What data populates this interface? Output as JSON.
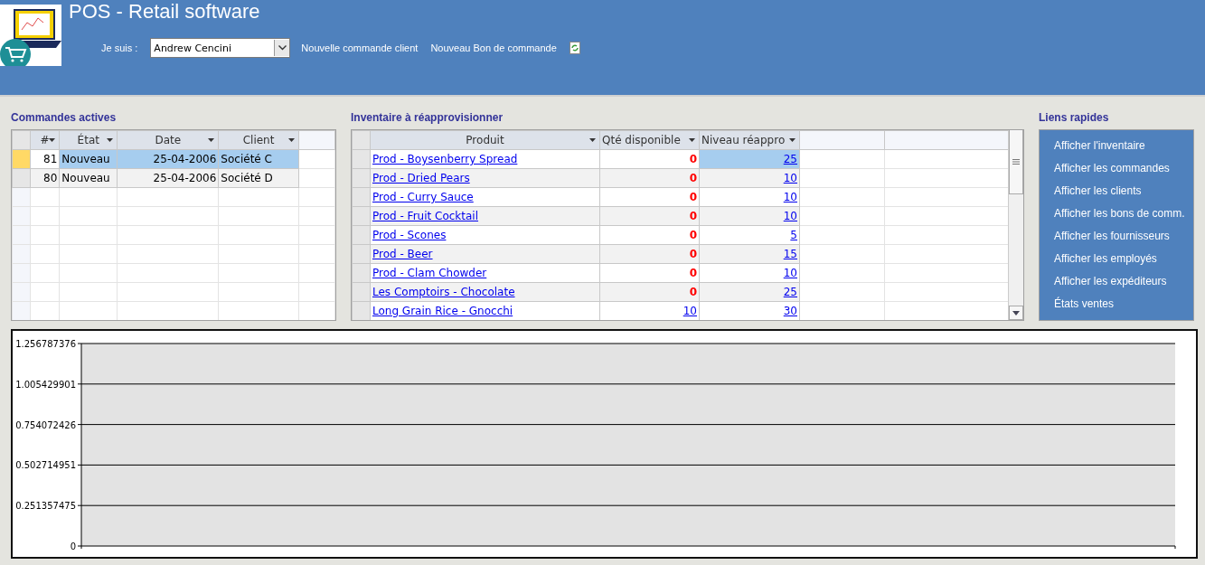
{
  "header": {
    "title": "POS - Retail software",
    "user_label": "Je suis :",
    "user_select": {
      "value": "Andrew Cencini"
    },
    "links": [
      "Nouvelle commande client",
      "Nouveau Bon de commande"
    ]
  },
  "orders": {
    "title": "Commandes actives",
    "columns": [
      "#",
      "État",
      "Date",
      "Client"
    ],
    "rows": [
      {
        "cells": [
          "81",
          "Nouveau",
          "25-04-2006",
          "Société C"
        ],
        "selected": true
      },
      {
        "cells": [
          "80",
          "Nouveau",
          "25-04-2006",
          "Société D"
        ],
        "selected": false
      }
    ]
  },
  "inventory": {
    "title": "Inventaire à réapprovisionner",
    "columns": [
      "Produit",
      "Qté disponible",
      "Niveau réappro"
    ],
    "rows": [
      {
        "product": "Prod - Boysenberry Spread",
        "qty": "0",
        "qty_alert": true,
        "level": "25",
        "selected": true
      },
      {
        "product": "Prod - Dried Pears",
        "qty": "0",
        "qty_alert": true,
        "level": "10",
        "selected": false
      },
      {
        "product": "Prod - Curry Sauce",
        "qty": "0",
        "qty_alert": true,
        "level": "10",
        "selected": false
      },
      {
        "product": "Prod - Fruit Cocktail",
        "qty": "0",
        "qty_alert": true,
        "level": "10",
        "selected": false
      },
      {
        "product": "Prod - Scones",
        "qty": "0",
        "qty_alert": true,
        "level": "5",
        "selected": false
      },
      {
        "product": "Prod - Beer",
        "qty": "0",
        "qty_alert": true,
        "level": "15",
        "selected": false
      },
      {
        "product": "Prod - Clam Chowder",
        "qty": "0",
        "qty_alert": true,
        "level": "10",
        "selected": false
      },
      {
        "product": "Les Comptoirs - Chocolate",
        "qty": "0",
        "qty_alert": true,
        "level": "25",
        "selected": false
      },
      {
        "product": "Long Grain Rice - Gnocchi",
        "qty": "10",
        "qty_alert": false,
        "level": "30",
        "selected": false
      }
    ]
  },
  "quick_links": {
    "title": "Liens rapides",
    "items": [
      "Afficher l'inventaire",
      "Afficher les commandes",
      "Afficher les clients",
      "Afficher les bons de comm.",
      "Afficher les fournisseurs",
      "Afficher les employés",
      "Afficher les expéditeurs",
      "États ventes"
    ]
  },
  "chart": {
    "y_axis_labels": [
      "1.256787376",
      "1.005429901",
      "0.754072426",
      "0.502714951",
      "0.251357475",
      "0"
    ]
  }
}
